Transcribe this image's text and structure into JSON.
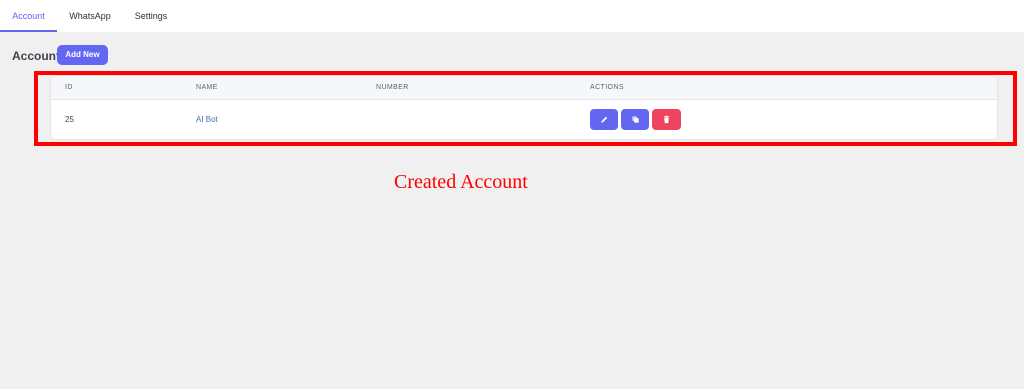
{
  "tabs": [
    {
      "label": "Account",
      "active": true
    },
    {
      "label": "WhatsApp",
      "active": false
    },
    {
      "label": "Settings",
      "active": false
    }
  ],
  "page": {
    "heading": "Account",
    "add_new_label": "Add New"
  },
  "table": {
    "columns": [
      "ID",
      "NAME",
      "NUMBER",
      "ACTIONS"
    ],
    "rows": [
      {
        "id": "25",
        "name": "AI Bot",
        "number": ""
      }
    ]
  },
  "row_actions": [
    "pencil-icon",
    "copy-icon",
    "trash-icon"
  ],
  "annotation": {
    "text": "Created Account",
    "color": "#ff0000"
  },
  "colors": {
    "accent": "#6366f1",
    "danger": "#ef4460",
    "highlight": "#ff0000"
  }
}
